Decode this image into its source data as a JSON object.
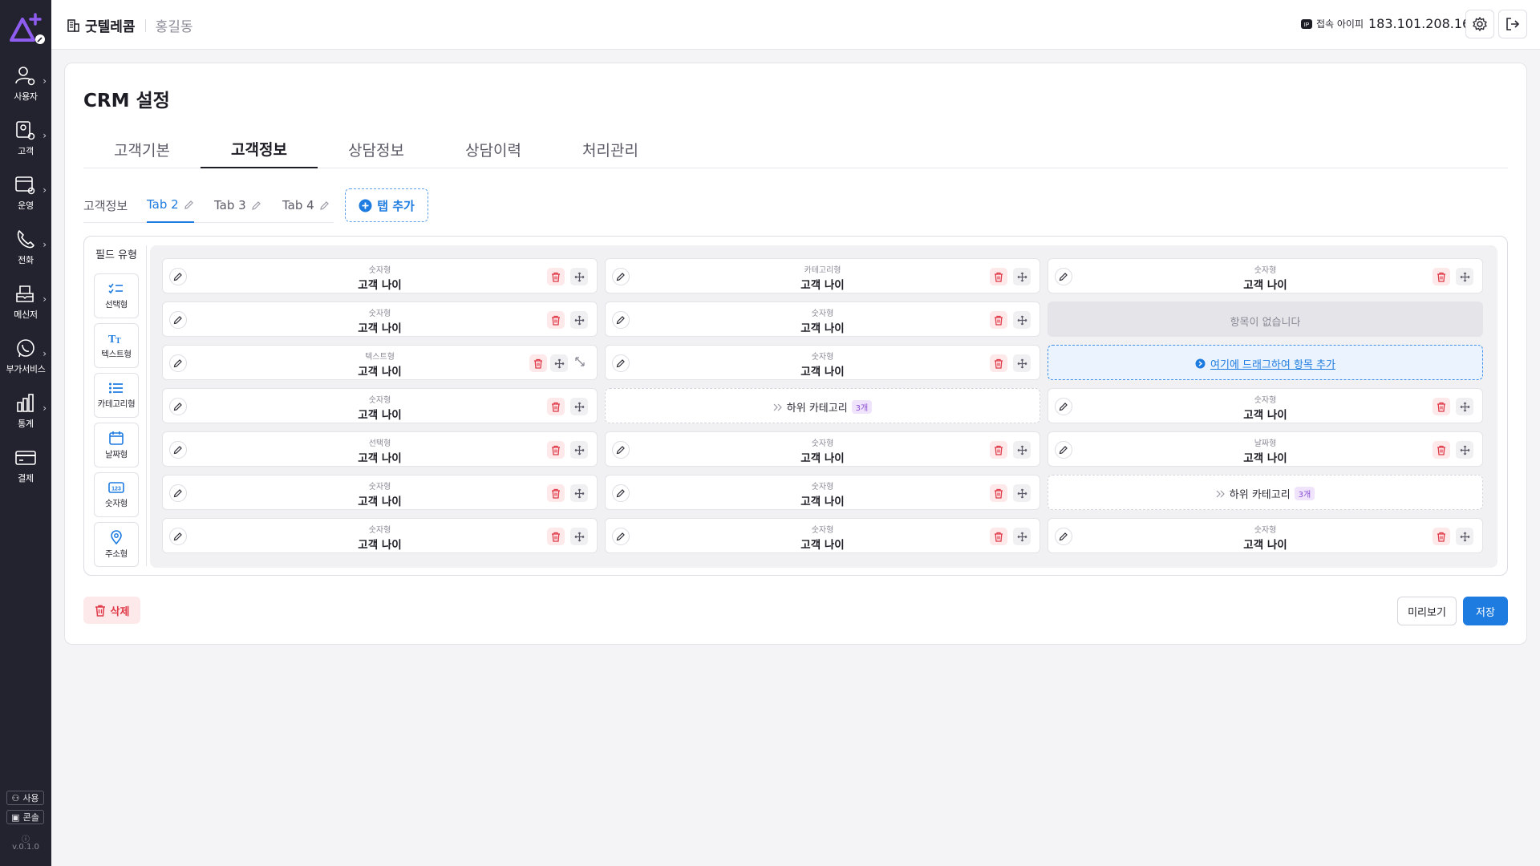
{
  "header": {
    "company_name": "굿텔레콤",
    "user_name": "홍길동",
    "ip_label": "접속 아이피",
    "ip_value": "183.101.208.16"
  },
  "sidebar": {
    "items": [
      {
        "label": "사용자",
        "icon": "user-gear-icon"
      },
      {
        "label": "고객",
        "icon": "customer-gear-icon"
      },
      {
        "label": "운영",
        "icon": "operation-gear-icon"
      },
      {
        "label": "전화",
        "icon": "phone-icon"
      },
      {
        "label": "메신저",
        "icon": "messenger-icon"
      },
      {
        "label": "부가서비스",
        "icon": "whatsapp-icon"
      },
      {
        "label": "통계",
        "icon": "chart-icon"
      },
      {
        "label": "결제",
        "icon": "card-icon"
      }
    ],
    "user_btn": "사용",
    "console_btn": "콘솔",
    "version": "v.0.1.0"
  },
  "page": {
    "title": "CRM 설정"
  },
  "main_tabs": [
    "고객기본",
    "고객정보",
    "상담정보",
    "상담이력",
    "처리관리"
  ],
  "main_tab_active": "고객정보",
  "sub_tabs": [
    "고객정보",
    "Tab 2",
    "Tab 3",
    "Tab 4"
  ],
  "sub_tab_active": "Tab 2",
  "add_tab_label": "탭 추가",
  "field_types": {
    "label": "필드 유형",
    "items": [
      "선택형",
      "텍스트형",
      "카테고리형",
      "날짜형",
      "숫자형",
      "주소형"
    ]
  },
  "grid": {
    "col1": [
      {
        "type": "숫자형",
        "name": "고객 나이"
      },
      {
        "type": "숫자형",
        "name": "고객 나이"
      },
      {
        "type": "텍스트형",
        "name": "고객 나이"
      },
      {
        "type": "숫자형",
        "name": "고객 나이"
      },
      {
        "type": "선택형",
        "name": "고객 나이"
      },
      {
        "type": "숫자형",
        "name": "고객 나이"
      },
      {
        "type": "숫자형",
        "name": "고객 나이"
      }
    ],
    "col2": [
      {
        "type": "카테고리형",
        "name": "고객 나이"
      },
      {
        "type": "숫자형",
        "name": "고객 나이"
      },
      {
        "type": "숫자형",
        "name": "고객 나이"
      },
      {
        "subcat_label": "하위 카테고리",
        "count": "3개"
      },
      {
        "type": "숫자형",
        "name": "고객 나이"
      },
      {
        "type": "숫자형",
        "name": "고객 나이"
      },
      {
        "type": "숫자형",
        "name": "고객 나이"
      }
    ],
    "col3": [
      {
        "type": "숫자형",
        "name": "고객 나이"
      },
      {
        "empty_text": "항목이 없습니다"
      },
      {
        "drop_text": "여기에 드래그하여 항목 추가"
      },
      {
        "type": "숫자형",
        "name": "고객 나이"
      },
      {
        "type": "날짜형",
        "name": "고객 나이"
      },
      {
        "subcat_label": "하위 카테고리",
        "count": "3개"
      },
      {
        "type": "숫자형",
        "name": "고객 나이"
      }
    ]
  },
  "actions": {
    "delete": "삭제",
    "preview": "미리보기",
    "save": "저장"
  },
  "colors": {
    "sidebar": "#23232f",
    "accent": "#1e7ce0",
    "danger": "#e03a48",
    "logo": "#8f5cf0"
  }
}
